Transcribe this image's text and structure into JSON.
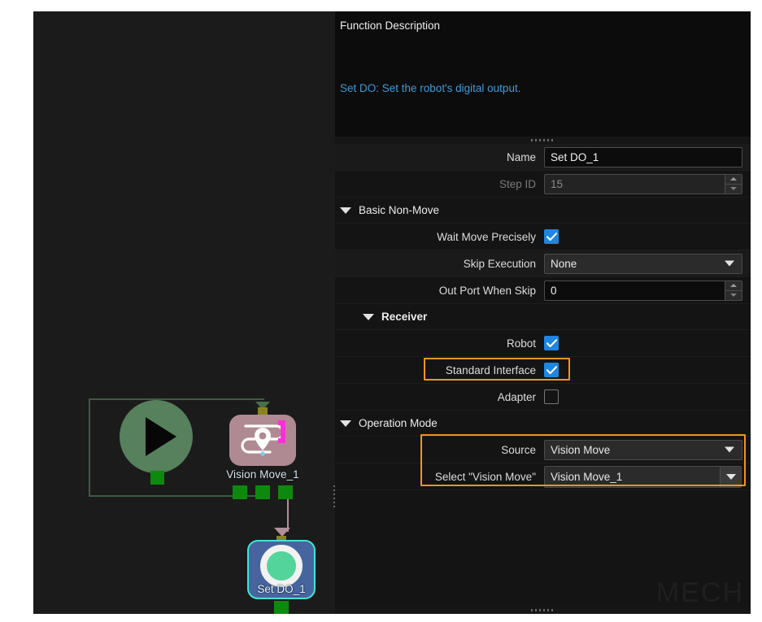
{
  "canvas": {
    "nodes": [
      {
        "name": "start-node",
        "label": "",
        "icon": "play-icon"
      },
      {
        "name": "vision-move-node",
        "label": "Vision Move_1",
        "icon": "vision-move-icon"
      },
      {
        "name": "set-do-node",
        "label": "Set DO_1",
        "icon": "set-do-icon"
      }
    ]
  },
  "panel": {
    "description": {
      "title": "Function Description",
      "body": "Set DO: Set the robot's digital output."
    },
    "fields": {
      "name_label": "Name",
      "name_value": "Set DO_1",
      "step_id_label": "Step ID",
      "step_id_value": "15"
    },
    "basic_non_move": {
      "title": "Basic Non-Move",
      "wait_move_label": "Wait Move Precisely",
      "wait_move_checked": "checked",
      "skip_execution_label": "Skip Execution",
      "skip_execution_value": "None",
      "out_port_label": "Out Port When Skip",
      "out_port_value": "0"
    },
    "receiver": {
      "title": "Receiver",
      "robot_label": "Robot",
      "robot_checked": "checked",
      "standard_interface_label": "Standard Interface",
      "standard_interface_checked": "checked",
      "adapter_label": "Adapter",
      "adapter_checked": "unchecked"
    },
    "operation_mode": {
      "title": "Operation Mode",
      "source_label": "Source",
      "source_value": "Vision Move",
      "select_label": "Select \"Vision Move\"",
      "select_value": "Vision Move_1"
    },
    "watermark": "MECH"
  },
  "colors": {
    "accent_highlight": "#f0961e",
    "checkbox_blue": "#1f86e0",
    "description_link": "#3f9ad6",
    "panel_bg": "#141414",
    "canvas_bg": "#1b1b1b",
    "set_do_node": "#46659e",
    "set_do_border": "#41e3d6",
    "vision_move_node": "#b08a92",
    "start_node": "#57805c",
    "port_green": "#0d8a0d"
  }
}
